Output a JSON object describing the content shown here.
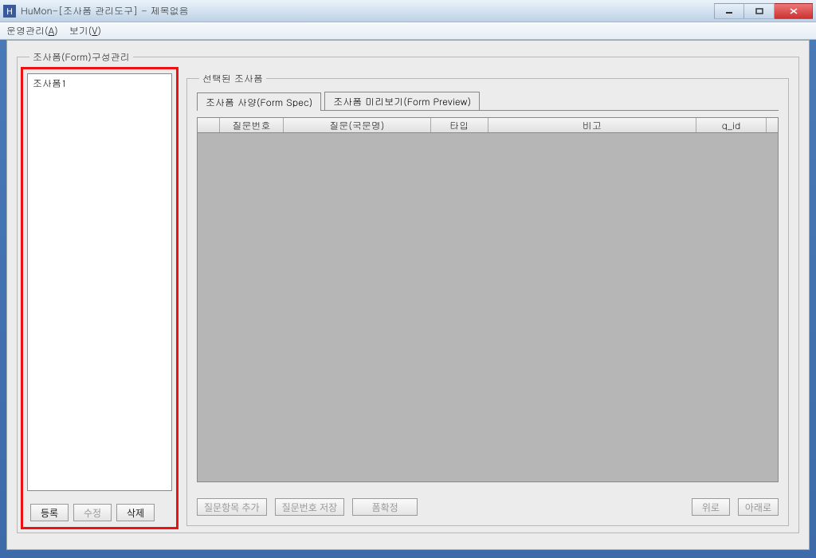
{
  "window": {
    "title": "HuMon-[조사폼 관리도구] - 제목없음",
    "icon_name": "app-icon"
  },
  "menubar": {
    "items": [
      {
        "label": "운영관리",
        "accel": "A"
      },
      {
        "label": "보기",
        "accel": "V"
      }
    ]
  },
  "outer_fieldset": {
    "legend": "조사폼(Form)구성관리"
  },
  "form_list": {
    "items": [
      "조사폼1"
    ]
  },
  "left_buttons": {
    "register": "등록",
    "modify": "수정",
    "delete": "삭제"
  },
  "selected_fieldset": {
    "legend": "선택된 조사폼"
  },
  "tabs": [
    {
      "label": "조사폼 사양(Form Spec)",
      "active": true
    },
    {
      "label": "조사폼 미리보기(Form Preview)",
      "active": false
    }
  ],
  "grid": {
    "columns": [
      "질문번호",
      "질문(국문명)",
      "타입",
      "비고",
      "q_id"
    ]
  },
  "bottom_buttons": {
    "add": "질문항목 추가",
    "save": "질문번호 저장",
    "finalize": "폼확정",
    "up": "위로",
    "down": "아래로"
  }
}
